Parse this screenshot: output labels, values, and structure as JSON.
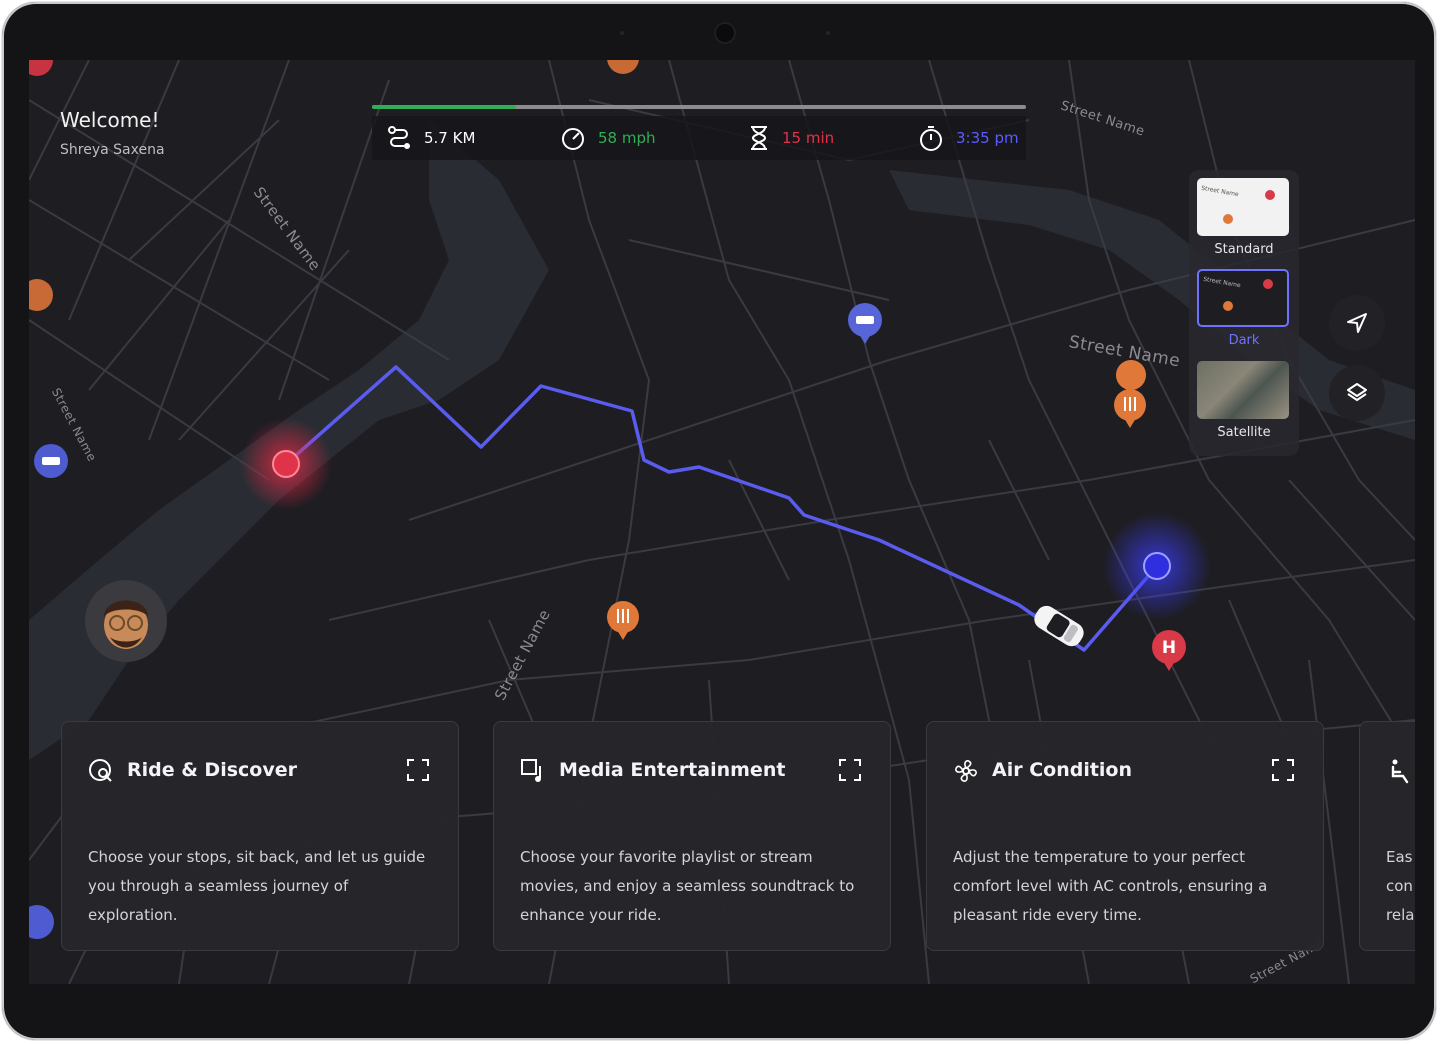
{
  "header": {
    "welcome": "Welcome!",
    "user_name": "Shreya Saxena"
  },
  "trip": {
    "progress_fraction": 0.22,
    "distance": "5.7 KM",
    "speed": "58 mph",
    "time_left": "15 min",
    "arrival": "3:35 pm"
  },
  "colors": {
    "distance": "#ffffff",
    "speed": "#2fae55",
    "time_left": "#e0334a",
    "arrival": "#5a5cff",
    "route": "#5a5cf0",
    "origin": "#e0334a",
    "destination": "#3b3df0"
  },
  "map": {
    "street_labels": [
      "Street Name",
      "Street Name",
      "Street Name",
      "Street Name",
      "Street Name",
      "Street Name"
    ]
  },
  "map_styles": {
    "selected": "Dark",
    "options": [
      {
        "label": "Standard",
        "thumb_street": "Street Name"
      },
      {
        "label": "Dark",
        "thumb_street": "Street Name"
      },
      {
        "label": "Satellite",
        "thumb_street": ""
      }
    ]
  },
  "controls": {
    "recenter_icon": "navigation-arrow-icon",
    "layers_icon": "layers-icon"
  },
  "cards": [
    {
      "title": "Ride & Discover",
      "icon": "search-location-icon",
      "description": "Choose your stops, sit back, and let us guide you through a seamless journey of exploration."
    },
    {
      "title": "Media Entertainment",
      "icon": "media-music-icon",
      "description": "Choose your favorite playlist or stream movies, and enjoy a seamless soundtrack to enhance your ride."
    },
    {
      "title": "Air Condition",
      "icon": "fan-icon",
      "description": "Adjust the temperature to your perfect comfort level with AC controls, ensuring a pleasant ride every time."
    },
    {
      "title": "",
      "icon": "seat-icon",
      "description": "Eas con rela"
    }
  ]
}
